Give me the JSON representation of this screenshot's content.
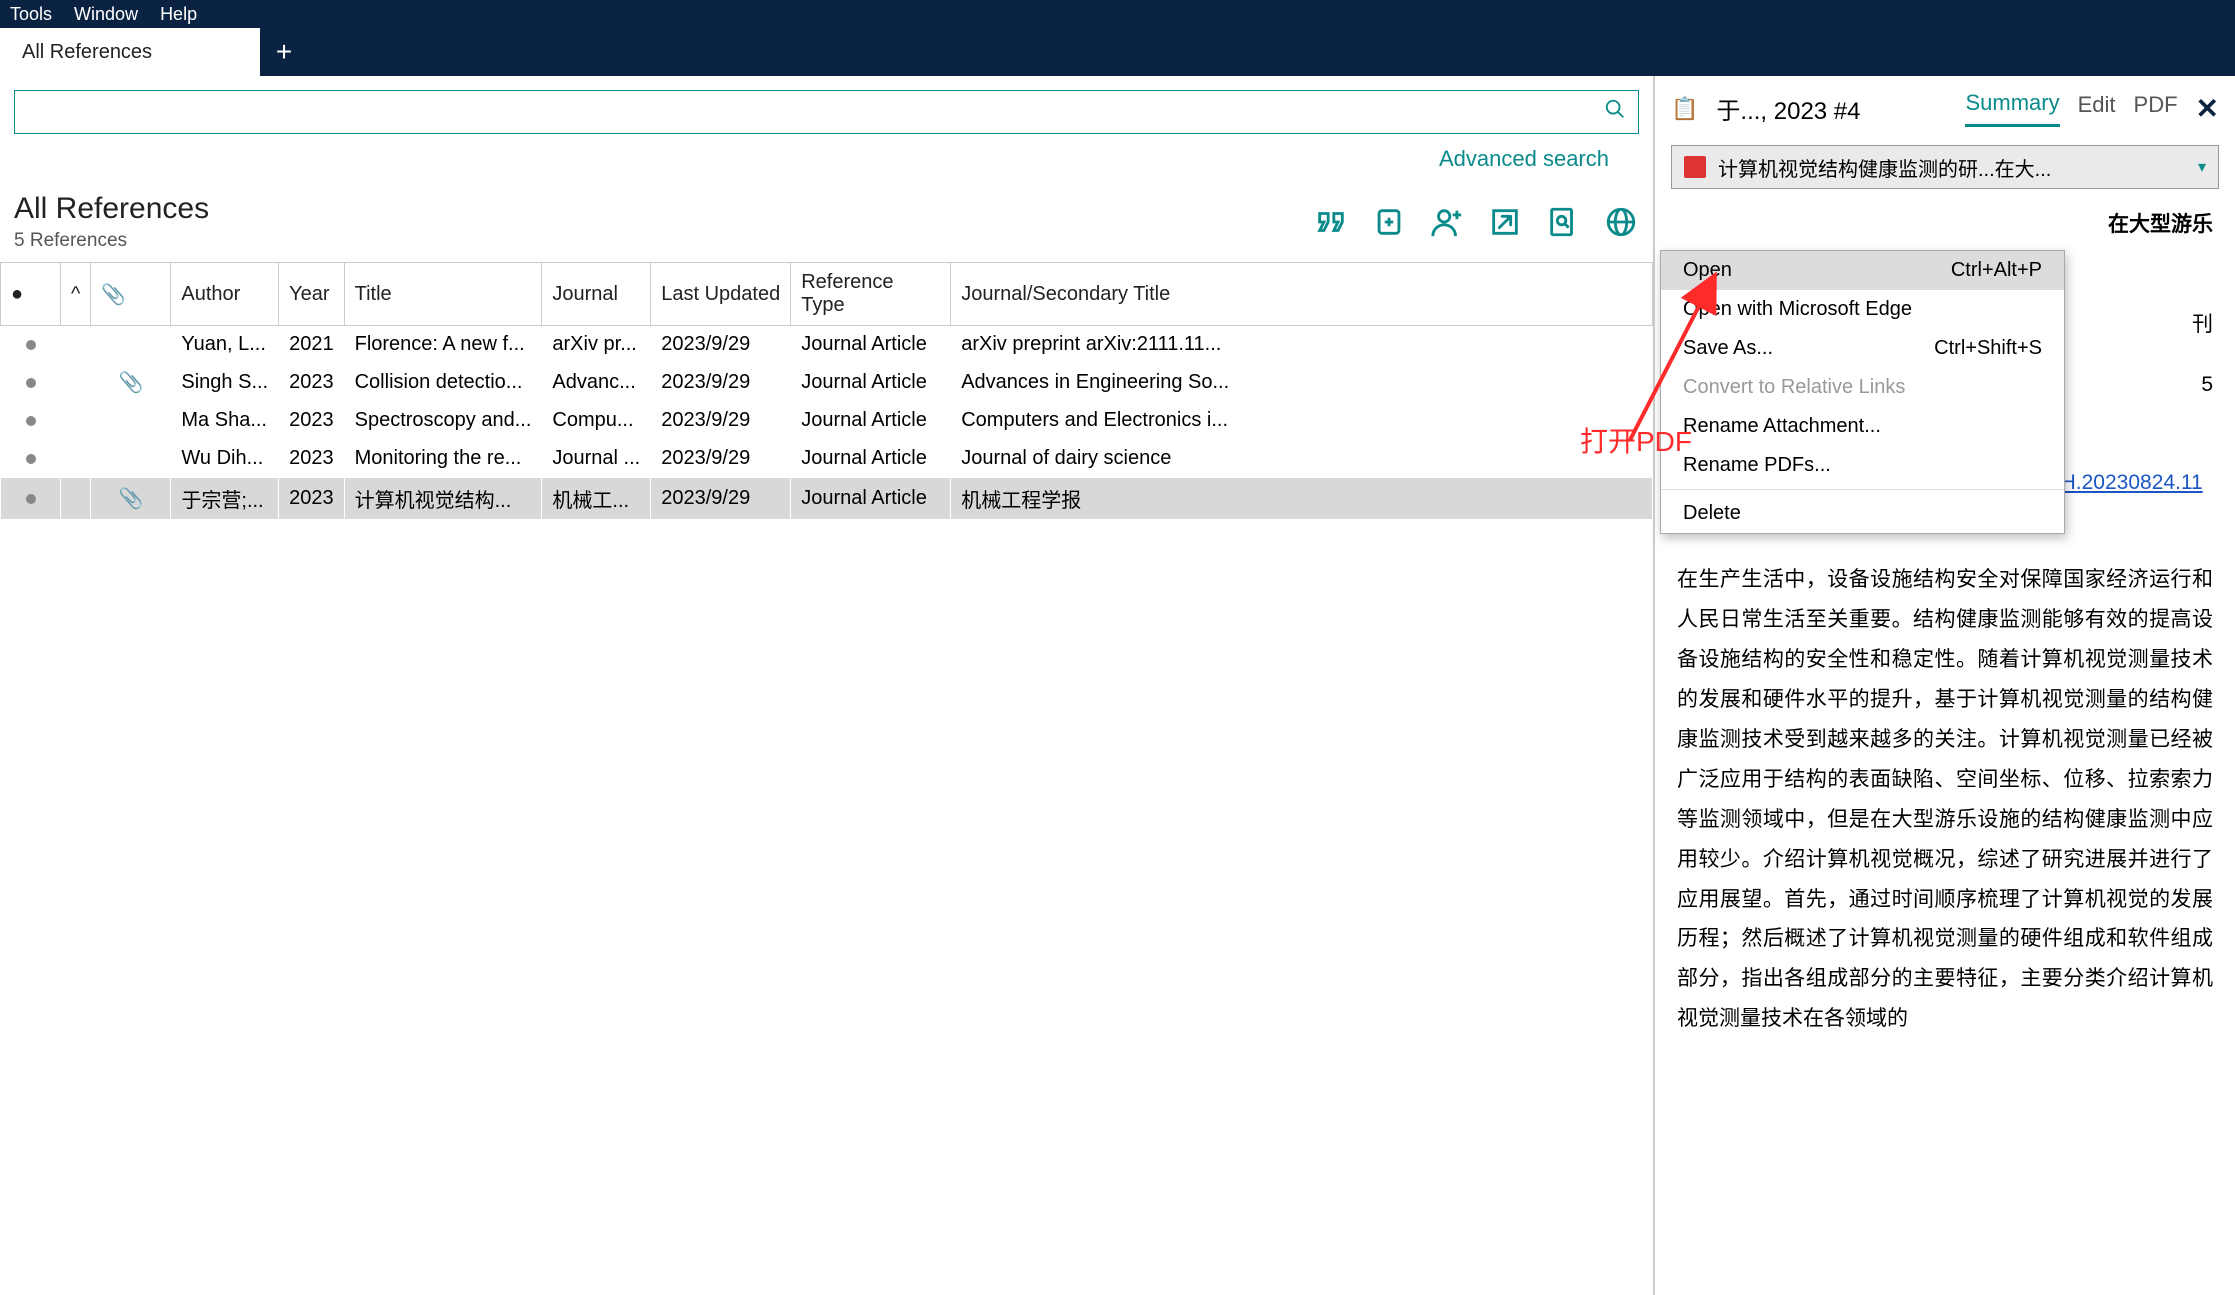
{
  "menu": {
    "tools": "Tools",
    "window": "Window",
    "help": "Help"
  },
  "tabs": {
    "main": "All References"
  },
  "search": {
    "placeholder": "",
    "advanced": "Advanced search"
  },
  "list": {
    "title": "All References",
    "count": "5 References"
  },
  "columns": {
    "author": "Author",
    "year": "Year",
    "title": "Title",
    "journal": "Journal",
    "updated": "Last Updated",
    "reftype": "Reference Type",
    "jst": "Journal/Secondary Title"
  },
  "rows": [
    {
      "clip": false,
      "author": "Yuan, L...",
      "year": "2021",
      "title": "Florence: A new f...",
      "journal": "arXiv pr...",
      "updated": "2023/9/29",
      "reftype": "Journal Article",
      "jst": "arXiv preprint arXiv:2111.11..."
    },
    {
      "clip": true,
      "author": "Singh S...",
      "year": "2023",
      "title": "Collision detectio...",
      "journal": "Advanc...",
      "updated": "2023/9/29",
      "reftype": "Journal Article",
      "jst": "Advances in Engineering So..."
    },
    {
      "clip": false,
      "author": "Ma Sha...",
      "year": "2023",
      "title": "Spectroscopy and...",
      "journal": "Compu...",
      "updated": "2023/9/29",
      "reftype": "Journal Article",
      "jst": "Computers and Electronics i..."
    },
    {
      "clip": false,
      "author": "Wu Dih...",
      "year": "2023",
      "title": "Monitoring the re...",
      "journal": "Journal ...",
      "updated": "2023/9/29",
      "reftype": "Journal Article",
      "jst": "Journal of dairy science"
    },
    {
      "clip": true,
      "author": "于宗营;...",
      "year": "2023",
      "title": "计算机视觉结构...",
      "journal": "机械工...",
      "updated": "2023/9/29",
      "reftype": "Journal Article",
      "jst": "机械工程学报"
    }
  ],
  "detail": {
    "header": "于..., 2023 #4",
    "tabs": {
      "summary": "Summary",
      "edit": "Edit",
      "pdf": "PDF"
    },
    "pdf_name": "计算机视觉结构健康监测的研...在大...",
    "title_partial_right": "在大型游乐",
    "meta1": "刊",
    "meta2": "5",
    "link": "https://kns.cnki.net/kcms/detail/11.2187.TH.20230824.1144.043.html",
    "abstract": "在生产生活中，设备设施结构安全对保障国家经济运行和人民日常生活至关重要。结构健康监测能够有效的提高设备设施结构的安全性和稳定性。随着计算机视觉测量技术的发展和硬件水平的提升，基于计算机视觉测量的结构健康监测技术受到越来越多的关注。计算机视觉测量已经被广泛应用于结构的表面缺陷、空间坐标、位移、拉索索力等监测领域中，但是在大型游乐设施的结构健康监测中应用较少。介绍计算机视觉概况，综述了研究进展并进行了应用展望。首先，通过时间顺序梳理了计算机视觉的发展历程；然后概述了计算机视觉测量的硬件组成和软件组成部分，指出各组成部分的主要特征，主要分类介绍计算机视觉测量技术在各领域的"
  },
  "ctx": {
    "open": "Open",
    "open_sc": "Ctrl+Alt+P",
    "open_edge": "Open with Microsoft Edge",
    "save_as": "Save As...",
    "save_sc": "Ctrl+Shift+S",
    "convert": "Convert to Relative Links",
    "rename_att": "Rename Attachment...",
    "rename_pdf": "Rename PDFs...",
    "delete": "Delete"
  },
  "annotation": {
    "text": "打开PDF"
  }
}
